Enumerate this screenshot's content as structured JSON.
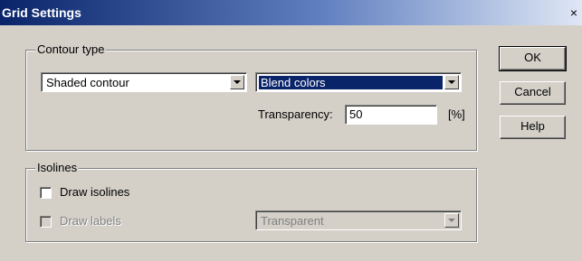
{
  "window": {
    "title": "Grid Settings",
    "close_glyph": "×"
  },
  "contour_group": {
    "legend": "Contour type",
    "type_select": "Shaded contour",
    "color_select": "Blend colors",
    "transparency_label": "Transparency:",
    "transparency_value": "50",
    "transparency_unit": "[%]"
  },
  "isolines_group": {
    "legend": "Isolines",
    "draw_isolines_label": "Draw isolines",
    "draw_isolines_checked": false,
    "draw_labels_label": "Draw labels",
    "draw_labels_checked": false,
    "labels_select": "Transparent"
  },
  "buttons": {
    "ok": "OK",
    "cancel": "Cancel",
    "help": "Help"
  },
  "icons": {
    "close": "close-icon",
    "dropdown": "chevron-down-icon"
  },
  "colors": {
    "titlebar_start": "#0a246a",
    "face": "#d4d0c8",
    "selection": "#0a246a"
  }
}
